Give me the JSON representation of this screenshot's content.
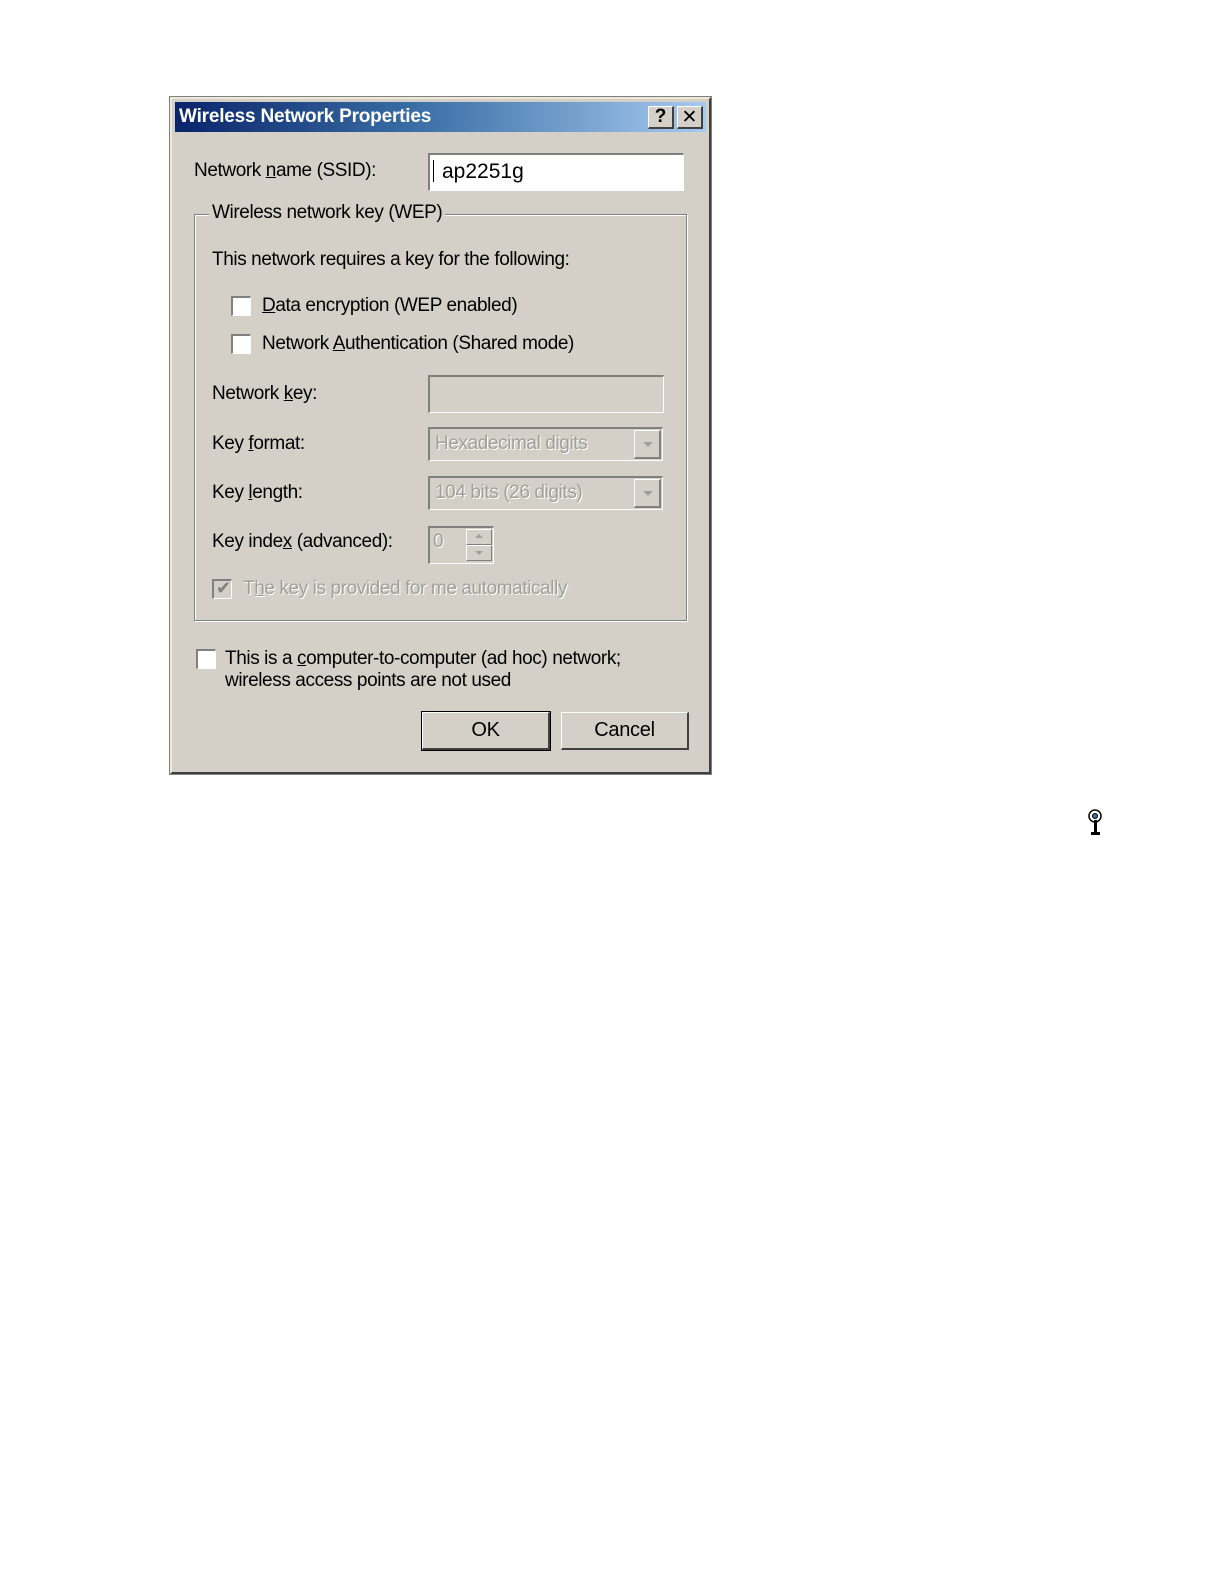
{
  "window": {
    "title": "Wireless Network Properties",
    "help_glyph": "?",
    "close_glyph": "✕"
  },
  "ssid": {
    "label_pre": "Network ",
    "label_ul": "n",
    "label_post": "ame (SSID):",
    "value": "ap2251g"
  },
  "wep_group": {
    "legend": "Wireless network key (WEP)",
    "intro": "This network requires a key for the following:",
    "data_encryption": {
      "ul": "D",
      "rest": "ata encryption (WEP enabled)",
      "checked": false
    },
    "network_auth": {
      "pre": "Network ",
      "ul": "A",
      "rest": "uthentication (Shared mode)",
      "checked": false
    },
    "network_key": {
      "pre": "Network ",
      "ul": "k",
      "post": "ey:",
      "value": ""
    },
    "key_format": {
      "pre": "Key ",
      "ul": "f",
      "post": "ormat:",
      "selected": "Hexadecimal digits"
    },
    "key_length": {
      "pre": "Key ",
      "ul": "l",
      "post": "ength:",
      "selected": "104 bits (26 digits)"
    },
    "key_index": {
      "pre": "Key inde",
      "ul": "x",
      "post": " (advanced):",
      "value": "0"
    },
    "auto_key": {
      "pre": "T",
      "ul": "h",
      "post": "e key is provided for me automatically",
      "checked": true
    }
  },
  "adhoc": {
    "pre": "This is a ",
    "ul": "c",
    "post": "omputer-to-computer (ad hoc) network;",
    "line2": "wireless access points are not used",
    "checked": false
  },
  "buttons": {
    "ok": "OK",
    "cancel": "Cancel"
  }
}
